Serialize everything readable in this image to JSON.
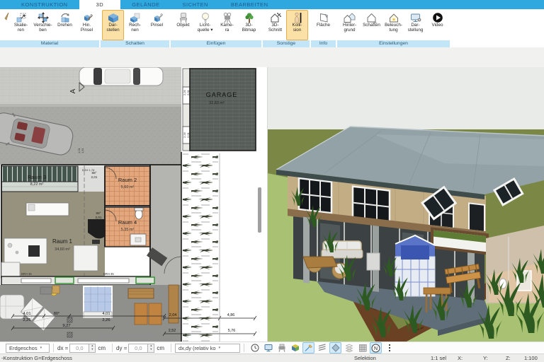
{
  "colors": {
    "tab_blue": "#2FA8E0",
    "group_band": "#C3E5F8",
    "button_highlight": "#FCE1A6",
    "highlight_border": "#E8AE4E",
    "toolbar_highlight": "#D6EBF9",
    "roof_gray": "#93A2A7",
    "lawn_green": "#A9C173",
    "tile_orange": "#E2A77D"
  },
  "ribbon": {
    "tabs": [
      {
        "label": "KONSTRUKTION"
      },
      {
        "label": "3D",
        "active": true
      },
      {
        "label": "GELÄNDE"
      },
      {
        "label": "SICHTEN"
      },
      {
        "label": "BEARBEITEN"
      }
    ],
    "groups": [
      {
        "label": "Material",
        "buttons": [
          {
            "label": "Skalie-\nren"
          },
          {
            "label": "Verschie-\nben"
          },
          {
            "label": "Drehen"
          },
          {
            "label": "Hin.\nPinsel"
          }
        ]
      },
      {
        "label": "Schatten",
        "buttons": [
          {
            "label": "Dar-\nstellen"
          },
          {
            "label": "Rech-\nnen"
          },
          {
            "label": "Pinsel"
          }
        ]
      },
      {
        "label": "Einfügen",
        "buttons": [
          {
            "label": "Objekt"
          },
          {
            "label": "Licht-\nquelle ▾"
          },
          {
            "label": "Kame-\nra"
          },
          {
            "label": "3D-\nBitmap"
          }
        ]
      },
      {
        "label": "Sonstige",
        "buttons": [
          {
            "label": "3D-\nSchnitt"
          },
          {
            "label": "Kolli-\nsion"
          }
        ]
      },
      {
        "label": "Info",
        "buttons": [
          {
            "label": "Fläche"
          }
        ]
      },
      {
        "label": "Einstellungen",
        "buttons": [
          {
            "label": "Hinter-\ngrund"
          },
          {
            "label": "Schatten"
          },
          {
            "label": "Beleuch-\ntung"
          },
          {
            "label": "Dar-\nstellung"
          },
          {
            "label": "Video"
          }
        ]
      }
    ]
  },
  "plan": {
    "rooms": {
      "garage": {
        "name": "GARAGE",
        "area": "32,83 m²"
      },
      "raum1": {
        "name": "Raum 1",
        "area": "34,60 m²"
      },
      "raum2": {
        "name": "Raum 2",
        "area": "5,60 m²"
      },
      "raum3": {
        "name": "Raum 3",
        "area": "8,22 m²"
      },
      "raum4": {
        "name": "Raum 4",
        "area": "5,35 m²"
      }
    },
    "section_marker": "A",
    "dims": {
      "d1": "4,01",
      "d2": "2,26",
      "d3": "80°",
      "d4": "4,01",
      "d5": "2,26",
      "d6": "9,27",
      "d7": "2,04",
      "d8": "4,86",
      "d9": "2,52",
      "d10": "5,76"
    },
    "annotations": {
      "a1": "BRH 35",
      "a2": "BRH 35",
      "a3": "BRH 1,76",
      "a4": "88°",
      "a5": "2,01",
      "a6": "88°",
      "a7": "2,01",
      "a8": "2,26",
      "a9": "2,01",
      "a10": "2,26",
      "a11": "2,01",
      "a12": "1,01",
      "a13": "1,51"
    }
  },
  "toolbar": {
    "floor_select": "Erdgeschos",
    "dx_label": "dx =",
    "dx_value": "0,0",
    "unit1": "cm",
    "dy_label": "dy =",
    "dy_value": "0,0",
    "unit2": "cm",
    "mode_select": "dx,dy (relativ ko",
    "north_label": "N"
  },
  "statusbar": {
    "context": "-Konstruktion G=Erdgeschoss",
    "selection": "Selektion",
    "sel_scale": "1:1 sel",
    "x_label": "X:",
    "y_label": "Y:",
    "z_label": "Z:",
    "scale": "1:100"
  }
}
